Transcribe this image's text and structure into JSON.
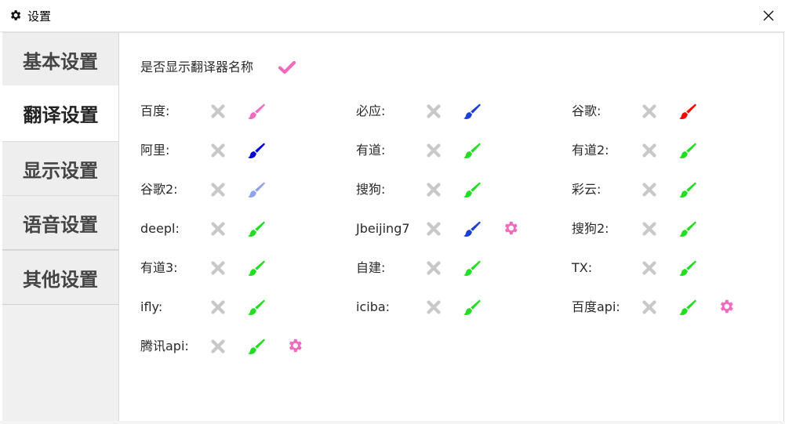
{
  "window": {
    "title": "设置"
  },
  "tabs": [
    {
      "label": "基本设置"
    },
    {
      "label": "翻译设置"
    },
    {
      "label": "显示设置"
    },
    {
      "label": "语音设置"
    },
    {
      "label": "其他设置"
    }
  ],
  "active_tab": "翻译设置",
  "show_name": {
    "label": "是否显示翻译器名称",
    "checked": true,
    "check_color": "#f06ac0"
  },
  "translators": [
    {
      "label": "百度:",
      "enabled": false,
      "brush_color": "#f06ac0",
      "settings": false
    },
    {
      "label": "必应:",
      "enabled": false,
      "brush_color": "#1c3fd6",
      "settings": false
    },
    {
      "label": "谷歌:",
      "enabled": false,
      "brush_color": "#ff0000",
      "settings": false
    },
    {
      "label": "阿里:",
      "enabled": false,
      "brush_color": "#0000d0",
      "settings": false
    },
    {
      "label": "有道:",
      "enabled": false,
      "brush_color": "#22dd22",
      "settings": false
    },
    {
      "label": "有道2:",
      "enabled": false,
      "brush_color": "#22dd22",
      "settings": false
    },
    {
      "label": "谷歌2:",
      "enabled": false,
      "brush_color": "#8ea2ee",
      "settings": false
    },
    {
      "label": "搜狗:",
      "enabled": false,
      "brush_color": "#22dd22",
      "settings": false
    },
    {
      "label": "彩云:",
      "enabled": false,
      "brush_color": "#22dd22",
      "settings": false
    },
    {
      "label": "deepl:",
      "enabled": false,
      "brush_color": "#22dd22",
      "settings": false
    },
    {
      "label": "Jbeijing7",
      "enabled": false,
      "brush_color": "#1c3fd6",
      "settings": true
    },
    {
      "label": "搜狗2:",
      "enabled": false,
      "brush_color": "#22dd22",
      "settings": false
    },
    {
      "label": "有道3:",
      "enabled": false,
      "brush_color": "#22dd22",
      "settings": false
    },
    {
      "label": "自建:",
      "enabled": false,
      "brush_color": "#22dd22",
      "settings": false
    },
    {
      "label": "TX:",
      "enabled": false,
      "brush_color": "#22dd22",
      "settings": false
    },
    {
      "label": "ifly:",
      "enabled": false,
      "brush_color": "#22dd22",
      "settings": false
    },
    {
      "label": "iciba:",
      "enabled": false,
      "brush_color": "#22dd22",
      "settings": false
    },
    {
      "label": "百度api:",
      "enabled": false,
      "brush_color": "#22dd22",
      "settings": true
    },
    {
      "label": "腾讯api:",
      "enabled": false,
      "brush_color": "#22dd22",
      "settings": true
    }
  ],
  "colors": {
    "disabled_x": "#c8c8c8",
    "gear": "#f06ac0"
  },
  "icons": {
    "window": "gear-icon",
    "close": "close-icon",
    "toggle": "x-icon",
    "color": "brush-icon",
    "settings": "gear-icon"
  }
}
